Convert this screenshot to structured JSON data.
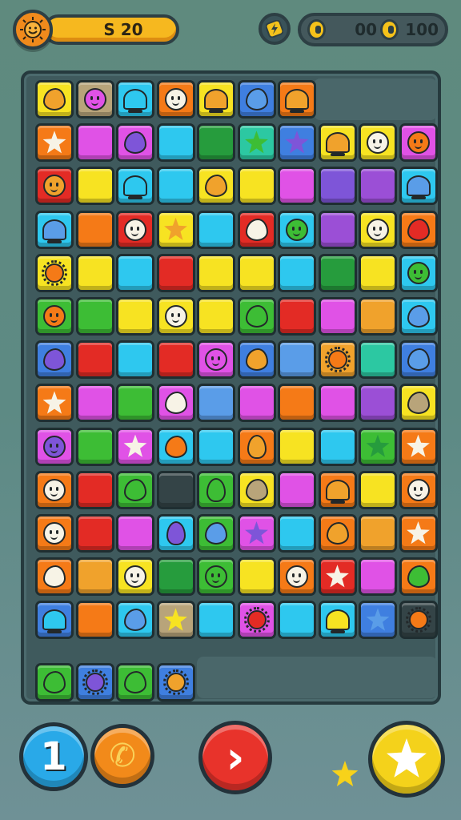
{
  "hud": {
    "score": "S 20",
    "coins_a": "00",
    "coins_b": "100"
  },
  "icons": {
    "avatar": "sun-face-icon",
    "bolt": "lightning-bolt-icon",
    "coin": "coin-icon"
  },
  "palette": {
    "R": "#e32b25",
    "O": "#f57a17",
    "Y": "#f7e322",
    "G": "#3dbd35",
    "D": "#269c3d",
    "C": "#2ec8ef",
    "B": "#3f7fe0",
    "P": "#9b4fd6",
    "M": "#e052e6",
    "T": "#2cc8a2",
    "K": "#344447",
    "W": "#b8a47a",
    "S": "#f7f3e6",
    "N": "#f0a22c",
    "V": "#7e55d8",
    "L": "#5a9de8"
  },
  "board": {
    "rows": [
      [
        "Y:blob:N",
        "W:face:M",
        "C:bell:C",
        "O:face:S",
        "Y:bell:N",
        "B:blob:L",
        "O:bell:N"
      ],
      [
        "O:star:S",
        "M",
        "M:blob:V",
        "C",
        "D",
        "T:star:G",
        "B:star:V",
        "Y:bell:N",
        "Y:face:S",
        "M:face:O"
      ],
      [
        "R:face:N",
        "Y",
        "C:bell:C",
        "C",
        "Y:blob:N",
        "Y",
        "M",
        "V",
        "P",
        "C:bell:L"
      ],
      [
        "C:bell:L",
        "O",
        "R:face:S",
        "Y:star:N",
        "C",
        "R:blob:S",
        "C:face:G",
        "P",
        "Y:face:S",
        "O:blob:R"
      ],
      [
        "Y:sun:O",
        "Y",
        "C",
        "R",
        "Y",
        "Y",
        "C",
        "D",
        "Y",
        "C:face:G"
      ],
      [
        "G:face:O",
        "G",
        "Y",
        "Y:face:S",
        "Y",
        "G:blob:G",
        "R",
        "M",
        "N",
        "C:blob:L"
      ],
      [
        "B:blob:V",
        "R",
        "C",
        "R",
        "M:face:M",
        "B:blob:N",
        "L",
        "N:sun:O",
        "T",
        "B:blob:L"
      ],
      [
        "O:star:S",
        "M",
        "G",
        "M:blob:S",
        "L",
        "M",
        "O",
        "M",
        "P",
        "Y:blob:W"
      ],
      [
        "M:face:V",
        "G",
        "M:star:S",
        "C:blob:O",
        "C",
        "O:egg:N",
        "Y",
        "C",
        "G:star:D",
        "O:star:S"
      ],
      [
        "O:face:S",
        "R",
        "G:blob:G",
        "K",
        "G:egg:G",
        "Y:blob:W",
        "M",
        "O:bell:N",
        "Y",
        "O:face:S"
      ],
      [
        "O:face:S",
        "R",
        "M",
        "C:egg:V",
        "G:blob:L",
        "M:star:V",
        "C",
        "O:blob:N",
        "N",
        "O:star:S"
      ],
      [
        "O:blob:S",
        "N",
        "Y:face:S",
        "D",
        "G:face:G",
        "Y",
        "O:face:S",
        "R:star:S",
        "M",
        "O:blob:G"
      ],
      [
        "B:bell:C",
        "O",
        "C:blob:L",
        "W:star:Y",
        "C",
        "M:sun:R",
        "C",
        "C:bell:Y",
        "B:star:L",
        "K:sun:O"
      ],
      [
        "G:blob:G",
        "B:sun:V",
        "G:blob:G",
        "B:sun:N"
      ]
    ]
  },
  "controls": {
    "left_label": "1",
    "phone_label": "✆",
    "next_label": "›",
    "icons": [
      "one-button-icon",
      "phone-icon",
      "next-arrow-icon",
      "star-icon"
    ]
  }
}
